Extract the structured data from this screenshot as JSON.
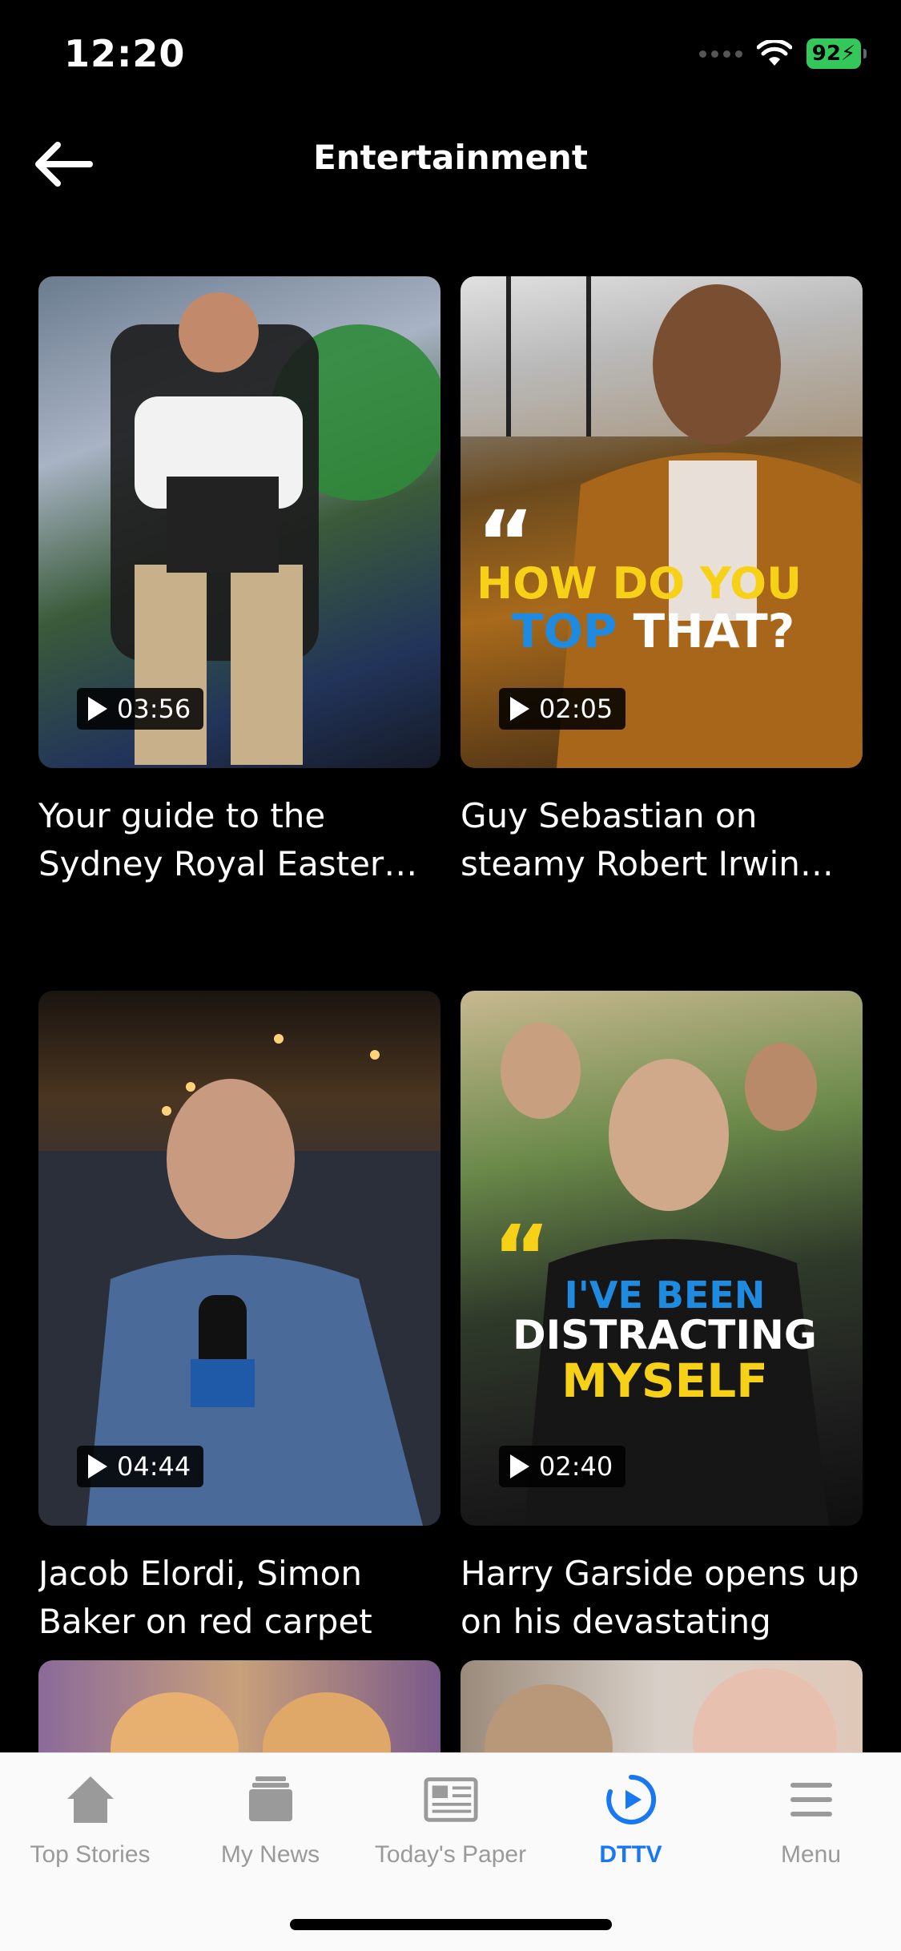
{
  "status": {
    "time": "12:20",
    "battery": "92"
  },
  "header": {
    "title": "Entertainment",
    "back_icon": "arrow-left-icon"
  },
  "videos": [
    {
      "title": "Your guide to the Sydney Royal Easter Show",
      "duration": "03:56"
    },
    {
      "title": "Guy Sebastian on steamy Robert Irwin dance",
      "duration": "02:05",
      "overlay": [
        "HOW DO YOU",
        "TOP",
        "THAT?"
      ]
    },
    {
      "title": "Jacob Elordi, Simon Baker on red carpet",
      "duration": "04:44"
    },
    {
      "title": "Harry Garside opens up on his devastating",
      "duration": "02:40",
      "overlay": [
        "I'VE BEEN",
        "DISTRACTING",
        "MYSELF"
      ]
    }
  ],
  "tabbar": {
    "items": [
      {
        "label": "Top Stories",
        "icon": "home-icon"
      },
      {
        "label": "My News",
        "icon": "stack-icon"
      },
      {
        "label": "Today's Paper",
        "icon": "newspaper-icon"
      },
      {
        "label": "DTTV",
        "icon": "play-circle-icon",
        "active": true
      },
      {
        "label": "Menu",
        "icon": "hamburger-icon"
      }
    ],
    "active_color": "#1877f2",
    "inactive_color": "#9a9a9a"
  }
}
